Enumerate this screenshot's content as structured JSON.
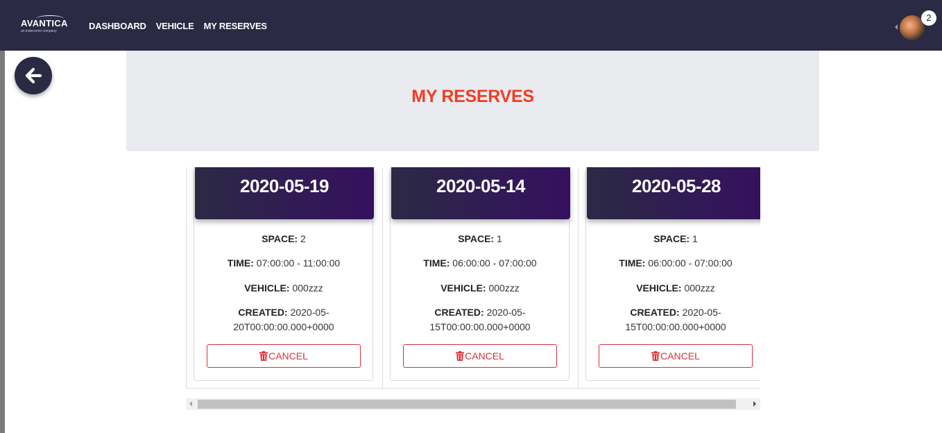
{
  "navbar": {
    "logo_text": "AVANTICA",
    "logo_tagline": "an indecomm company",
    "links": [
      "DASHBOARD",
      "VEHICLE",
      "MY RESERVES"
    ],
    "notification_count": "2"
  },
  "page": {
    "title": "MY RESERVES"
  },
  "labels": {
    "space": "SPACE:",
    "time": "TIME:",
    "vehicle": "VEHICLE:",
    "created": "CREATED:",
    "cancel": "CANCEL"
  },
  "reserves": [
    {
      "date": "2020-05-19",
      "space": "2",
      "time": "07:00:00 - 11:00:00",
      "vehicle": "000zzz",
      "created_line1": "2020-05-",
      "created_line2": "20T00:00:00.000+0000"
    },
    {
      "date": "2020-05-14",
      "space": "1",
      "time": "06:00:00 - 07:00:00",
      "vehicle": "000zzz",
      "created_line1": "2020-05-",
      "created_line2": "15T00:00:00.000+0000"
    },
    {
      "date": "2020-05-28",
      "space": "1",
      "time": "06:00:00 - 07:00:00",
      "vehicle": "000zzz",
      "created_line1": "2020-05-",
      "created_line2": "15T00:00:00.000+0000"
    }
  ],
  "colors": {
    "navbar": "#2b2a44",
    "title": "#f23c25",
    "cancel": "#d9303a",
    "banner": "#e9ebee"
  },
  "icons": {
    "back": "arrow-left-icon",
    "cancel": "trash-icon"
  }
}
